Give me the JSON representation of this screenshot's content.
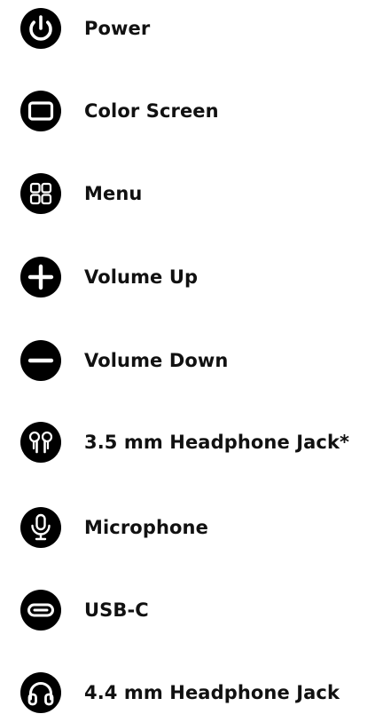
{
  "colors": {
    "icon_fill": "#000000",
    "icon_glyph": "#ffffff",
    "text": "#111111",
    "background": "#ffffff"
  },
  "items": [
    {
      "label": "Power",
      "icon": "power-icon"
    },
    {
      "label": "Color Screen",
      "icon": "screen-icon"
    },
    {
      "label": "Menu",
      "icon": "menu-grid-icon"
    },
    {
      "label": "Volume Up",
      "icon": "plus-icon"
    },
    {
      "label": "Volume Down",
      "icon": "minus-icon"
    },
    {
      "label": "3.5 mm Headphone Jack*",
      "icon": "earbuds-icon"
    },
    {
      "label": "Microphone",
      "icon": "microphone-icon"
    },
    {
      "label": "USB-C",
      "icon": "usb-c-icon"
    },
    {
      "label": "4.4 mm Headphone Jack",
      "icon": "headphones-icon"
    }
  ]
}
